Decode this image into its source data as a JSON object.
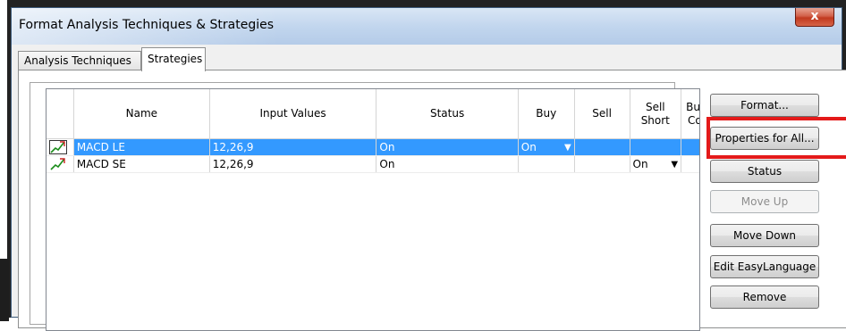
{
  "window": {
    "title": "Format Analysis Techniques & Strategies",
    "close_label": "x"
  },
  "tabs": [
    {
      "label": "Analysis Techniques",
      "active": false
    },
    {
      "label": "Strategies",
      "active": true
    }
  ],
  "table": {
    "columns": [
      "",
      "Name",
      "Input Values",
      "Status",
      "Buy",
      "Sell",
      "Sell Short",
      "Buy to Cover"
    ],
    "rows": [
      {
        "name": "MACD LE",
        "input_values": "12,26,9",
        "status": "On",
        "buy": "On",
        "sell": "",
        "sell_short": "",
        "buy_to_cover": "",
        "selected": true
      },
      {
        "name": "MACD SE",
        "input_values": "12,26,9",
        "status": "On",
        "buy": "",
        "sell": "",
        "sell_short": "On",
        "buy_to_cover": "",
        "selected": false
      }
    ]
  },
  "buttons": {
    "format": "Format...",
    "properties_for_all": "Properties for All...",
    "status": "Status",
    "move_up": "Move Up",
    "move_down": "Move Down",
    "edit_easylanguage": "Edit EasyLanguage",
    "remove": "Remove"
  },
  "colors": {
    "selection": "#3399ff",
    "highlight_box": "#e41a1a"
  },
  "icons": [
    "strategy-icon",
    "dropdown-arrow-icon"
  ]
}
